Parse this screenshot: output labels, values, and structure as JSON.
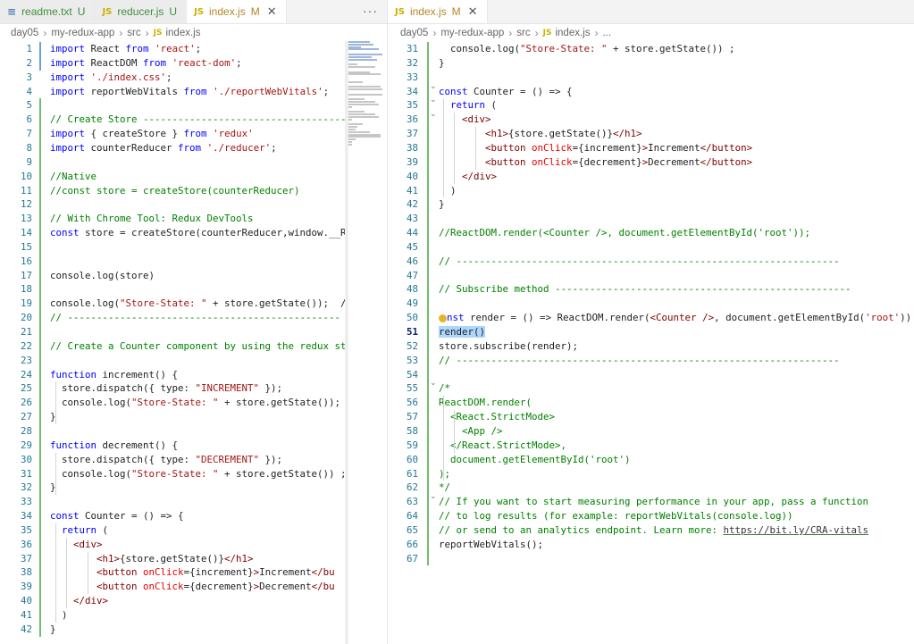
{
  "left": {
    "tabs": [
      {
        "icon": "≡",
        "name": "readme.txt",
        "status": "U",
        "kind": "txt"
      },
      {
        "icon": "JS",
        "name": "reducer.js",
        "status": "U",
        "kind": "js"
      },
      {
        "icon": "JS",
        "name": "index.js",
        "status": "M",
        "kind": "js",
        "active": true
      }
    ],
    "more_label": "···",
    "breadcrumb": [
      "day05",
      "my-redux-app",
      "src",
      "index.js"
    ],
    "lines": [
      {
        "n": "1",
        "code": "<span class=\"kw\">import</span> React <span class=\"kw\">from</span> <span class=\"str\">'react'</span>;"
      },
      {
        "n": "2",
        "code": "<span class=\"kw\">import</span> ReactDOM <span class=\"kw\">from</span> <span class=\"str\">'react-dom'</span>;"
      },
      {
        "n": "3",
        "code": "<span class=\"kw\">import</span> <span class=\"str\">'./index.css'</span>;"
      },
      {
        "n": "4",
        "code": "<span class=\"kw\">import</span> reportWebVitals <span class=\"kw\">from</span> <span class=\"str\">'./reportWebVitals'</span>;"
      },
      {
        "n": "5",
        "code": ""
      },
      {
        "n": "6",
        "code": "<span class=\"com\">// Create Store -----------------------------------</span>"
      },
      {
        "n": "7",
        "code": "<span class=\"kw\">import</span> { createStore } <span class=\"kw\">from</span> <span class=\"str\">'redux'</span>"
      },
      {
        "n": "8",
        "code": "<span class=\"kw\">import</span> counterReducer <span class=\"kw\">from</span> <span class=\"str\">'./reducer'</span>;"
      },
      {
        "n": "9",
        "code": ""
      },
      {
        "n": "10",
        "code": "<span class=\"com\">//Native</span>"
      },
      {
        "n": "11",
        "code": "<span class=\"com\">//const store = createStore(counterReducer)</span>"
      },
      {
        "n": "12",
        "code": ""
      },
      {
        "n": "13",
        "code": "<span class=\"com\">// With Chrome Tool: Redux DevTools</span>"
      },
      {
        "n": "14",
        "code": "<span class=\"kw\">const</span> store = createStore(counterReducer,window.__R"
      },
      {
        "n": "15",
        "code": ""
      },
      {
        "n": "16",
        "code": ""
      },
      {
        "n": "17",
        "code": "console.log(store)"
      },
      {
        "n": "18",
        "code": ""
      },
      {
        "n": "19",
        "code": "console.log(<span class=\"str\">\"Store-State: \"</span> + store.getState());  /"
      },
      {
        "n": "20",
        "code": "<span class=\"com\">// -----------------------------------------------</span>"
      },
      {
        "n": "21",
        "code": ""
      },
      {
        "n": "22",
        "code": "<span class=\"com\">// Create a Counter component by using the redux st</span>"
      },
      {
        "n": "23",
        "code": ""
      },
      {
        "n": "24",
        "code": "<span class=\"kw\">function</span> increment() {"
      },
      {
        "n": "25",
        "code": "  store.dispatch({ type: <span class=\"str\">\"INCREMENT\"</span> });"
      },
      {
        "n": "26",
        "code": "  console.log(<span class=\"str\">\"Store-State: \"</span> + store.getState());"
      },
      {
        "n": "27",
        "code": "}"
      },
      {
        "n": "28",
        "code": ""
      },
      {
        "n": "29",
        "code": "<span class=\"kw\">function</span> decrement() {"
      },
      {
        "n": "30",
        "code": "  store.dispatch({ type: <span class=\"str\">\"DECREMENT\"</span> });"
      },
      {
        "n": "31",
        "code": "  console.log(<span class=\"str\">\"Store-State: \"</span> + store.getState()) ;"
      },
      {
        "n": "32",
        "code": "}"
      },
      {
        "n": "33",
        "code": ""
      },
      {
        "n": "34",
        "code": "<span class=\"kw\">const</span> Counter = () => {"
      },
      {
        "n": "35",
        "code": "  <span class=\"kw\">return</span> ("
      },
      {
        "n": "36",
        "code": "    <span class=\"tag\">&lt;div&gt;</span>"
      },
      {
        "n": "37",
        "code": "        <span class=\"tag\">&lt;h1&gt;</span>{store.getState()}<span class=\"tag\">&lt;/h1&gt;</span>"
      },
      {
        "n": "38",
        "code": "        <span class=\"tag\">&lt;button</span> <span class=\"attr\">onClick</span>={increment}<span class=\"tag\">&gt;</span>Increment<span class=\"tag\">&lt;/bu</span>"
      },
      {
        "n": "39",
        "code": "        <span class=\"tag\">&lt;button</span> <span class=\"attr\">onClick</span>={decrement}<span class=\"tag\">&gt;</span>Decrement<span class=\"tag\">&lt;/bu</span>"
      },
      {
        "n": "40",
        "code": "    <span class=\"tag\">&lt;/div&gt;</span>"
      },
      {
        "n": "41",
        "code": "  )"
      },
      {
        "n": "42",
        "code": "}"
      }
    ]
  },
  "right": {
    "tabs": [
      {
        "icon": "JS",
        "name": "index.js",
        "status": "M",
        "kind": "js",
        "active": true
      }
    ],
    "breadcrumb": [
      "day05",
      "my-redux-app",
      "src",
      "index.js",
      "..."
    ],
    "lines": [
      {
        "n": "31",
        "code": "  console.log(<span class=\"str\">\"Store-State: \"</span> + store.getState()) ;"
      },
      {
        "n": "32",
        "code": "}"
      },
      {
        "n": "33",
        "code": ""
      },
      {
        "n": "34",
        "code": "<span class=\"kw\">const</span> Counter = () => {"
      },
      {
        "n": "35",
        "code": "  <span class=\"kw\">return</span> ("
      },
      {
        "n": "36",
        "code": "    <span class=\"tag\">&lt;div&gt;</span>"
      },
      {
        "n": "37",
        "code": "        <span class=\"tag\">&lt;h1&gt;</span>{store.getState()}<span class=\"tag\">&lt;/h1&gt;</span>"
      },
      {
        "n": "38",
        "code": "        <span class=\"tag\">&lt;button</span> <span class=\"attr\">onClick</span>={increment}<span class=\"tag\">&gt;</span>Increment<span class=\"tag\">&lt;/button&gt;</span>"
      },
      {
        "n": "39",
        "code": "        <span class=\"tag\">&lt;button</span> <span class=\"attr\">onClick</span>={decrement}<span class=\"tag\">&gt;</span>Decrement<span class=\"tag\">&lt;/button&gt;</span>"
      },
      {
        "n": "40",
        "code": "    <span class=\"tag\">&lt;/div&gt;</span>"
      },
      {
        "n": "41",
        "code": "  )"
      },
      {
        "n": "42",
        "code": "}"
      },
      {
        "n": "43",
        "code": ""
      },
      {
        "n": "44",
        "code": "<span class=\"com\">//ReactDOM.render(&lt;Counter /&gt;, document.getElementById('root'));</span>"
      },
      {
        "n": "45",
        "code": ""
      },
      {
        "n": "46",
        "code": "<span class=\"com\">// ------------------------------------------------------------------</span>"
      },
      {
        "n": "47",
        "code": ""
      },
      {
        "n": "48",
        "code": "<span class=\"com\">// Subscribe method ---------------------------------------------------</span>"
      },
      {
        "n": "49",
        "code": ""
      },
      {
        "n": "50",
        "code": "<span class=\"bulb\"></span><span class=\"kw\">nst</span> render = () => ReactDOM.render(<span class=\"tag\">&lt;Counter</span> <span class=\"tag\">/&gt;</span>, document.getElementById(<span class=\"str\">'root'</span>))"
      },
      {
        "n": "51",
        "code": "<span class=\"render-hl\">render()</span>"
      },
      {
        "n": "52",
        "code": "store.subscribe(render);"
      },
      {
        "n": "53",
        "code": "<span class=\"com\">// ------------------------------------------------------------------</span>"
      },
      {
        "n": "54",
        "code": ""
      },
      {
        "n": "55",
        "code": "<span class=\"com\">/*</span>"
      },
      {
        "n": "56",
        "code": "<span class=\"com\">ReactDOM.render(</span>"
      },
      {
        "n": "57",
        "code": "<span class=\"com\">  &lt;React.StrictMode&gt;</span>"
      },
      {
        "n": "58",
        "code": "<span class=\"com\">    &lt;App /&gt;</span>"
      },
      {
        "n": "59",
        "code": "<span class=\"com\">  &lt;/React.StrictMode&gt;,</span>"
      },
      {
        "n": "60",
        "code": "<span class=\"com\">  document.getElementById('root')</span>"
      },
      {
        "n": "61",
        "code": "<span class=\"com\">);</span>"
      },
      {
        "n": "62",
        "code": "<span class=\"com\">*/</span>"
      },
      {
        "n": "63",
        "code": "<span class=\"com\">// If you want to start measuring performance in your app, pass a function</span>"
      },
      {
        "n": "64",
        "code": "<span class=\"com\">// to log results (for example: reportWebVitals(console.log))</span>"
      },
      {
        "n": "65",
        "code": "<span class=\"com\">// or send to an analytics endpoint. Learn more: <span class=\"link\">https://bit.ly/CRA-vitals</span></span>"
      },
      {
        "n": "66",
        "code": "reportWebVitals();"
      },
      {
        "n": "67",
        "code": ""
      }
    ],
    "current_line": "51"
  },
  "colors": {
    "keyword": "#0000ff",
    "string": "#a31515",
    "comment": "#008000",
    "attribute": "#e50000",
    "tag": "#800000",
    "line_number": "#237893"
  }
}
